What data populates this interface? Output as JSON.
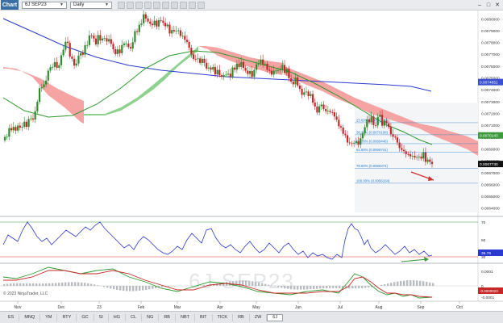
{
  "toolbar": {
    "chart_tab": "Chart",
    "instrument": "6J SEP23",
    "interval": "Daily",
    "icons": [
      "cursor-icon",
      "crosshair-icon",
      "zoom-icon",
      "draw-icon",
      "settings-icon",
      "properties-icon",
      "indicators-icon",
      "strategy-icon",
      "template-icon",
      "link-icon"
    ]
  },
  "watermark": "6J SEP23",
  "copyright": "© 2023 NinjaTrader, LLC",
  "price_labels": [
    "0.0080000",
    "0.0079000",
    "0.0078000",
    "0.0077000",
    "0.0076000",
    "0.0075000",
    "0.0074000",
    "0.0073000",
    "0.0072000",
    "0.0071000",
    "0.0070000",
    "0.0069000",
    "0.0068000",
    "0.0067000",
    "0.0066000",
    "0.0065000",
    "0.0064000"
  ],
  "price_markers": [
    {
      "text": "0.0074651",
      "color": "#3a4fd1",
      "value": 0.0074651
    },
    {
      "text": "0.0070143",
      "color": "#3c9a3c",
      "value": 0.0070143
    },
    {
      "text": "0.0067730",
      "color": "#111111",
      "value": 0.006773
    }
  ],
  "fib_labels": [
    {
      "text": "23.60% (0.0071220)",
      "value": 0.007122
    },
    {
      "text": "38.20% (0.0070199)",
      "value": 0.0070199
    },
    {
      "text": "50.00% (0.0069446)",
      "value": 0.0069446
    },
    {
      "text": "61.80% (0.0068741)",
      "value": 0.0068741
    },
    {
      "text": "78.60% (0.0068374)",
      "value": 0.0067374
    },
    {
      "text": "100.00% (0.0066104)",
      "value": 0.0066104
    }
  ],
  "rsi_labels": [
    "70",
    "50",
    "30"
  ],
  "rsi_marker": "35.76",
  "macd_labels": [
    "0.0001",
    "0",
    "-0.0001"
  ],
  "macd_marker": "-0.0000023",
  "x_labels": [
    "Nov",
    "Dec",
    "23",
    "Feb",
    "Mar",
    "Apr",
    "May",
    "Jun",
    "Jul",
    "Aug",
    "Sep",
    "Oct"
  ],
  "instrument_tabs": [
    "ES",
    "MNQ",
    "YM",
    "RTY",
    "GC",
    "SI",
    "HG",
    "CL",
    "NG",
    "RB",
    "NBT",
    "BIT",
    "TICK",
    "RB",
    "ZW",
    "6J"
  ],
  "active_tab": "6J",
  "colors": {
    "up": "#2e8b2e",
    "down": "#c62828",
    "sma_slow": "#2a3ad0",
    "sma_fast": "#2e9a2e",
    "cloud_bull": "#8fd18f",
    "cloud_bear": "#f5a3a3",
    "rsi": "#2a3ad0",
    "fib": "#2a7fd0"
  },
  "chart_data": {
    "type": "candlestick",
    "price_range": [
      0.00633,
      0.00807
    ],
    "closes": [
      0.007002,
      0.007003,
      0.007076,
      0.007058,
      0.007086,
      0.007055,
      0.007097,
      0.00708,
      0.007087,
      0.00713,
      0.007087,
      0.007154,
      0.007158,
      0.007149,
      0.007218,
      0.007298,
      0.007413,
      0.007422,
      0.007445,
      0.007478,
      0.007562,
      0.007591,
      0.007593,
      0.007634,
      0.007586,
      0.007607,
      0.007692,
      0.007738,
      0.007806,
      0.007796,
      0.007681,
      0.007662,
      0.007605,
      0.007622,
      0.007689,
      0.007711,
      0.007696,
      0.007777,
      0.007778,
      0.007859,
      0.007857,
      0.007833,
      0.007784,
      0.007863,
      0.007817,
      0.007833,
      0.007836,
      0.007808,
      0.007828,
      0.007788,
      0.007743,
      0.007702,
      0.007741,
      0.007709,
      0.007778,
      0.007791,
      0.007791,
      0.007761,
      0.007749,
      0.007802,
      0.007895,
      0.007888,
      0.007949,
      0.007961,
      0.008038,
      0.008002,
      0.007976,
      0.007958,
      0.007946,
      0.007984,
      0.007935,
      0.007988,
      0.007983,
      0.007966,
      0.007937,
      0.007951,
      0.007876,
      0.007905,
      0.007894,
      0.007898,
      0.007902,
      0.007855,
      0.007856,
      0.007822,
      0.007804,
      0.007755,
      0.007699,
      0.007661,
      0.007659,
      0.007665,
      0.007627,
      0.007662,
      0.007627,
      0.00758,
      0.007588,
      0.00757,
      0.007592,
      0.00753,
      0.007568,
      0.007523,
      0.007511,
      0.007524,
      0.007528,
      0.007536,
      0.007509,
      0.007588,
      0.00757,
      0.007621,
      0.007593,
      0.007634,
      0.007585,
      0.007562,
      0.007534,
      0.007558,
      0.00751,
      0.007569,
      0.007615,
      0.007624,
      0.007656,
      0.007616,
      0.00762,
      0.007569,
      0.007561,
      0.007528,
      0.007562,
      0.007562,
      0.007565,
      0.007572,
      0.00761,
      0.007542,
      0.007577,
      0.007498,
      0.007469,
      0.007446,
      0.007503,
      0.007436,
      0.007408,
      0.007357,
      0.007379,
      0.007385,
      0.007347,
      0.007364,
      0.007292,
      0.007259,
      0.007208,
      0.007261,
      0.007275,
      0.007237,
      0.007219,
      0.007222,
      0.007211,
      0.007209,
      0.007174,
      0.007147,
      0.007092,
      0.007081,
      0.007028,
      0.007016,
      0.006954,
      0.006948,
      0.006945,
      0.006951,
      0.006965,
      0.006936,
      0.00699,
      0.007031,
      0.007084,
      0.00715,
      0.007127,
      0.007174,
      0.007101,
      0.007099,
      0.007171,
      0.007188,
      0.007097,
      0.007139,
      0.007116,
      0.007085,
      0.007025,
      0.007004,
      0.006997,
      0.006954,
      0.006908,
      0.006892,
      0.006881,
      0.006856,
      0.006855,
      0.006838,
      0.006841,
      0.006828,
      0.006832,
      0.006836,
      0.006819,
      0.006871,
      0.006791,
      0.00681,
      0.006791,
      0.006773
    ]
  }
}
